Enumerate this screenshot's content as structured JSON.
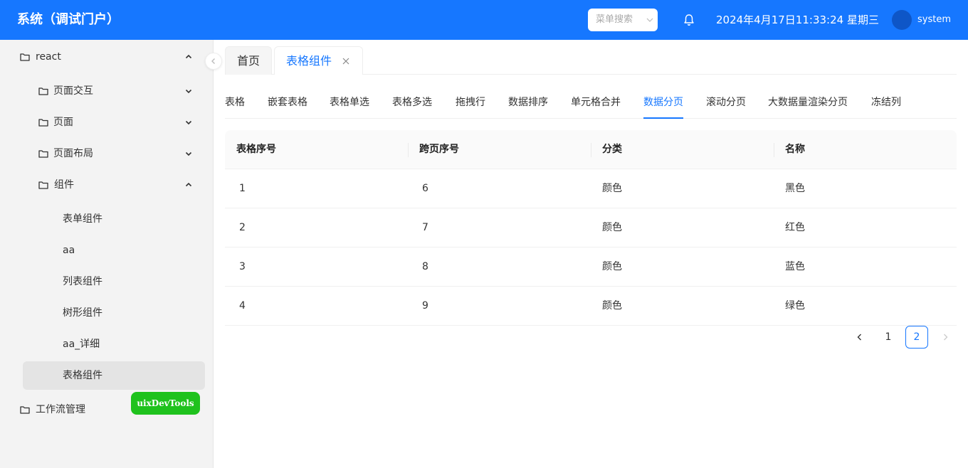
{
  "header": {
    "title": "系统（调试门户）",
    "menu_search_placeholder": "菜单搜索",
    "datetime": "2024年4月17日11:33:24 星期三",
    "username": "system",
    "accent_color": "#1677ff"
  },
  "sidebar": {
    "items": [
      {
        "label": "react",
        "icon": "folder-icon",
        "arrow": "chevron-up-icon"
      },
      {
        "label": "页面交互",
        "icon": "folder-icon",
        "arrow": "chevron-down-icon"
      },
      {
        "label": "页面",
        "icon": "folder-icon",
        "arrow": "chevron-down-icon"
      },
      {
        "label": "页面布局",
        "icon": "folder-icon",
        "arrow": "chevron-down-icon"
      },
      {
        "label": "组件",
        "icon": "folder-icon",
        "arrow": "chevron-up-icon"
      },
      {
        "label": "表单组件"
      },
      {
        "label": "aa"
      },
      {
        "label": "列表组件"
      },
      {
        "label": "树形组件"
      },
      {
        "label": "aa_详细"
      },
      {
        "label": "表格组件",
        "active": true
      },
      {
        "label": "工作流管理",
        "icon": "folder-icon"
      }
    ],
    "devtools_label": "uixDevTools"
  },
  "page_tabs": [
    {
      "label": "首页"
    },
    {
      "label": "表格组件",
      "active": true,
      "closable": true
    }
  ],
  "sub_tabs": [
    "表格",
    "嵌套表格",
    "表格单选",
    "表格多选",
    "拖拽行",
    "数据排序",
    "单元格合并",
    "数据分页",
    "滚动分页",
    "大数据量渲染分页",
    "冻结列"
  ],
  "active_sub_tab": "数据分页",
  "table": {
    "columns": [
      "表格序号",
      "跨页序号",
      "分类",
      "名称"
    ],
    "rows": [
      [
        "1",
        "6",
        "颜色",
        "黑色"
      ],
      [
        "2",
        "7",
        "颜色",
        "红色"
      ],
      [
        "3",
        "8",
        "颜色",
        "蓝色"
      ],
      [
        "4",
        "9",
        "颜色",
        "绿色"
      ]
    ]
  },
  "pagination": {
    "pages": [
      "1",
      "2"
    ],
    "current": "2"
  }
}
